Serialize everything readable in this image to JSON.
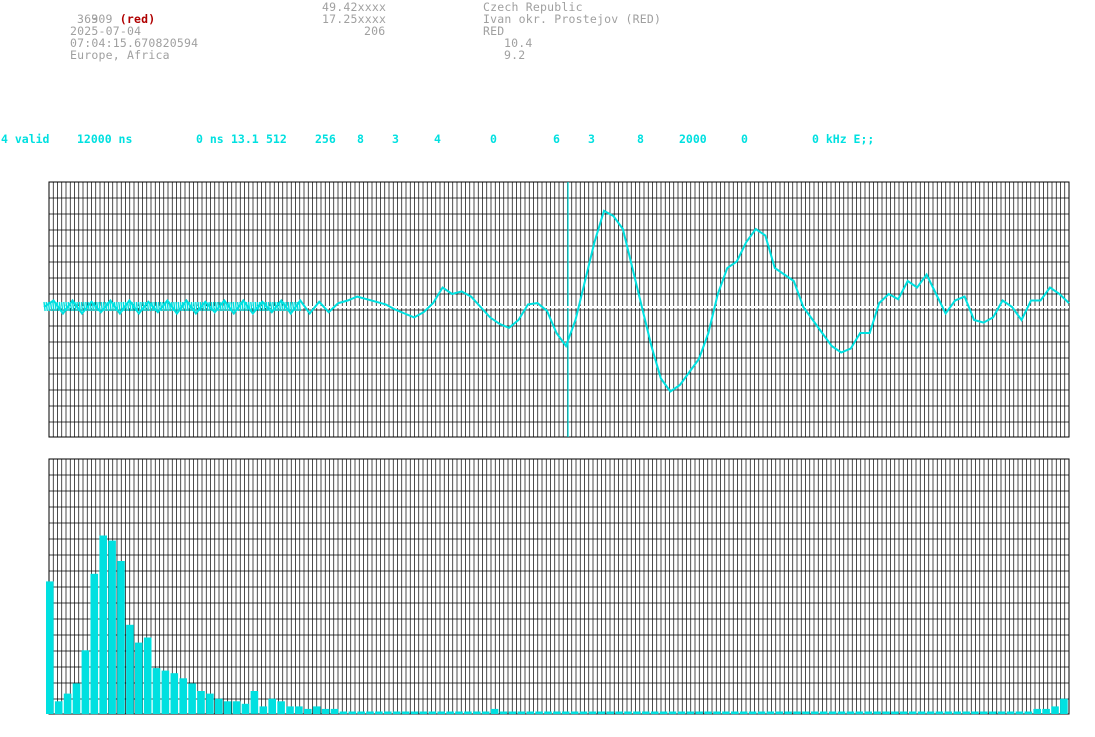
{
  "header": {
    "col1": {
      "line1_number": "909",
      "line1_tag": "(red)",
      "line2": "363",
      "date": "2025-07-04",
      "time": "07:04:15.670820594",
      "region": "Europe, Africa"
    },
    "col2": {
      "lat": "49.42xxxx",
      "lon": "17.25xxxx",
      "value": "206"
    },
    "col3": {
      "country": "Czech Republic",
      "station": "Ivan okr. Prostejov (RED)",
      "code": "RED",
      "val1": "10.4",
      "val2": "9.2"
    }
  },
  "status_bar": [
    "4 valid",
    "12000 ns",
    "0 ns",
    "13.1",
    "512",
    "256",
    "8",
    "3",
    "4",
    "0",
    "6",
    "3",
    "8",
    "2000",
    "0",
    "0 kHz E;;"
  ],
  "colors": {
    "trace": "#00e0e0",
    "grid": "#000000",
    "header_text": "#a0a0a0",
    "tag": "#b00000"
  },
  "waveform_panel": {
    "samples": [
      0,
      0.5,
      -0.5,
      0.5,
      -0.5,
      0.4,
      -0.4,
      0.5,
      -0.5,
      0.5,
      -0.5,
      0.4,
      -0.4,
      0.5,
      -0.5,
      0.5,
      -0.5,
      0.4,
      -0.4,
      0.5,
      -0.5,
      0.5,
      -0.5,
      0.4,
      -0.4,
      0.5,
      -0.5,
      0.5,
      -0.5,
      0.4,
      -0.4,
      0.3,
      0.5,
      0.8,
      0.6,
      0.4,
      0.2,
      -0.2,
      -0.5,
      -0.8,
      -0.4,
      0.3,
      1.5,
      1.0,
      1.2,
      0.8,
      0,
      -0.8,
      -1.3,
      -1.6,
      -1.0,
      0.2,
      0.3,
      -0.3,
      -2.0,
      -3.0,
      -1.0,
      2.0,
      5.0,
      7.4,
      7.0,
      6.0,
      3.0,
      0,
      -3.0,
      -5.5,
      -6.5,
      -6.0,
      -5.0,
      -4.0,
      -2.0,
      1.0,
      3.0,
      3.5,
      5.0,
      6.0,
      5.5,
      3.0,
      2.5,
      2.0,
      0,
      -1.0,
      -2.0,
      -3.0,
      -3.5,
      -3.2,
      -2.0,
      -2.0,
      0.3,
      1.0,
      0.6,
      2.0,
      1.5,
      2.5,
      1.0,
      -0.5,
      0.5,
      0.8,
      -1.0,
      -1.2,
      -0.8,
      0.5,
      0,
      -1.0,
      0.5,
      0.5,
      1.5,
      1.0,
      0.3
    ]
  },
  "spectrum_panel": {
    "bins": [
      0.52,
      0.05,
      0.08,
      0.12,
      0.25,
      0.55,
      0.7,
      0.68,
      0.6,
      0.35,
      0.28,
      0.3,
      0.18,
      0.17,
      0.16,
      0.14,
      0.12,
      0.09,
      0.08,
      0.06,
      0.05,
      0.05,
      0.04,
      0.09,
      0.03,
      0.06,
      0.05,
      0.03,
      0.03,
      0.02,
      0.03,
      0.02,
      0.02,
      0.01,
      0.01,
      0.01,
      0.01,
      0.01,
      0.01,
      0.01,
      0.01,
      0.01,
      0.01,
      0.01,
      0.01,
      0.01,
      0.01,
      0.01,
      0.01,
      0.01,
      0.02,
      0.01,
      0.01,
      0.01,
      0.01,
      0.01,
      0.01,
      0.01,
      0.01,
      0.01,
      0.01,
      0.01,
      0.01,
      0.01,
      0.01,
      0.01,
      0.01,
      0.01,
      0.01,
      0.01,
      0.01,
      0.01,
      0.01,
      0.01,
      0.01,
      0.01,
      0.01,
      0.01,
      0.01,
      0.01,
      0.01,
      0.01,
      0.01,
      0.01,
      0.01,
      0.01,
      0.01,
      0.01,
      0.01,
      0.01,
      0.01,
      0.01,
      0.01,
      0.01,
      0.01,
      0.01,
      0.01,
      0.01,
      0.01,
      0.01,
      0.01,
      0.01,
      0.01,
      0.01,
      0.01,
      0.01,
      0.01,
      0.01,
      0.01,
      0.01,
      0.01,
      0.02,
      0.02,
      0.03,
      0.06
    ]
  }
}
